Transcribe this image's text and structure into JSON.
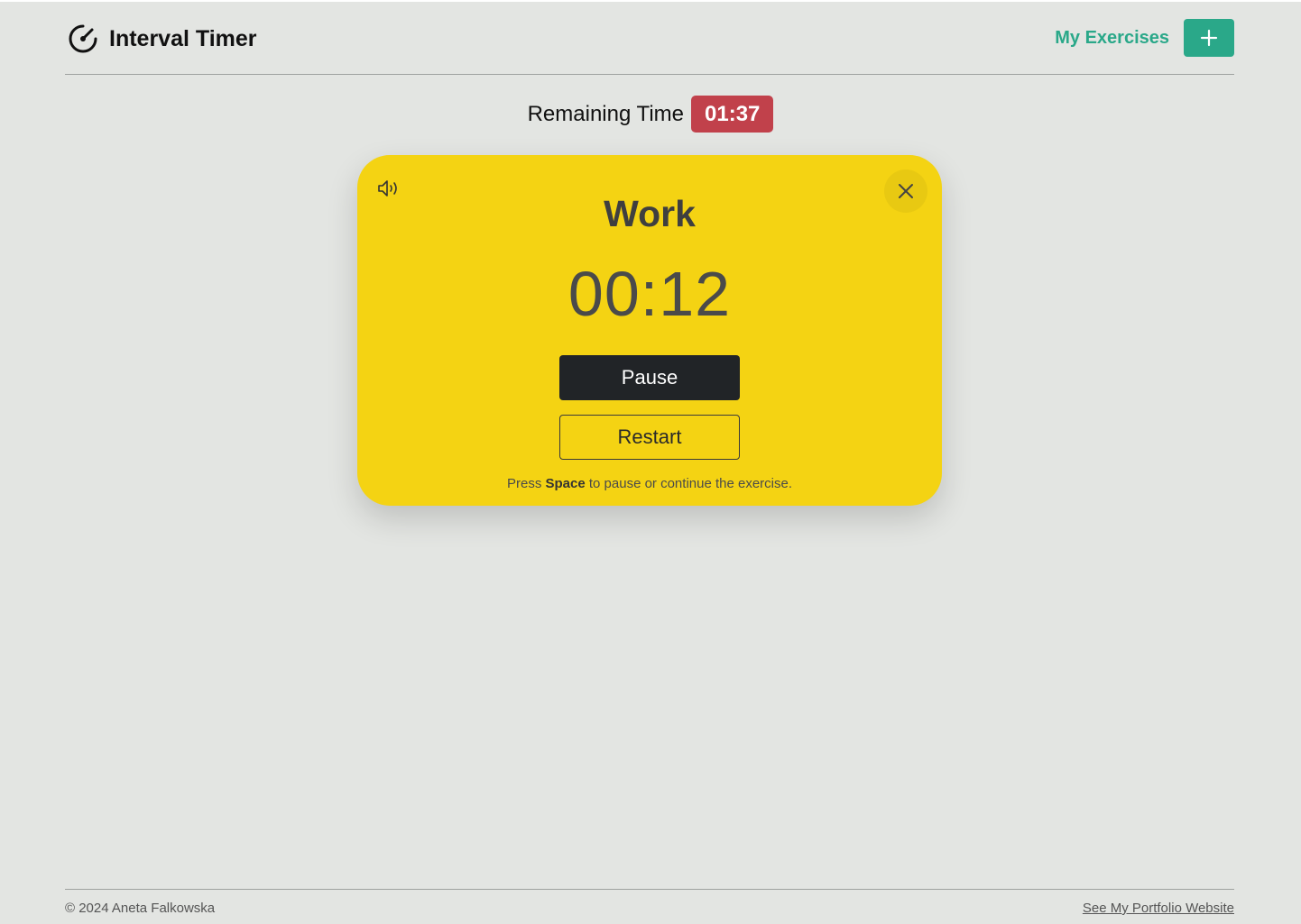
{
  "header": {
    "title": "Interval Timer",
    "icon": "speedometer-icon",
    "nav_link": "My Exercises",
    "add_icon": "plus-icon"
  },
  "remaining": {
    "label": "Remaining Time",
    "value": "01:37"
  },
  "card": {
    "sound_icon": "volume-icon",
    "close_icon": "close-icon",
    "phase": "Work",
    "time": "00:12",
    "pause_label": "Pause",
    "restart_label": "Restart",
    "hint_prefix": "Press",
    "hint_key": "Space",
    "hint_suffix": "to pause or continue the exercise."
  },
  "footer": {
    "copyright": "© 2024 Aneta Falkowska",
    "link": "See My Portfolio Website"
  },
  "colors": {
    "background": "#e3e5e2",
    "accent": "#2aa889",
    "card": "#f4d313",
    "badge": "#c1414b",
    "pause_button": "#212427"
  }
}
